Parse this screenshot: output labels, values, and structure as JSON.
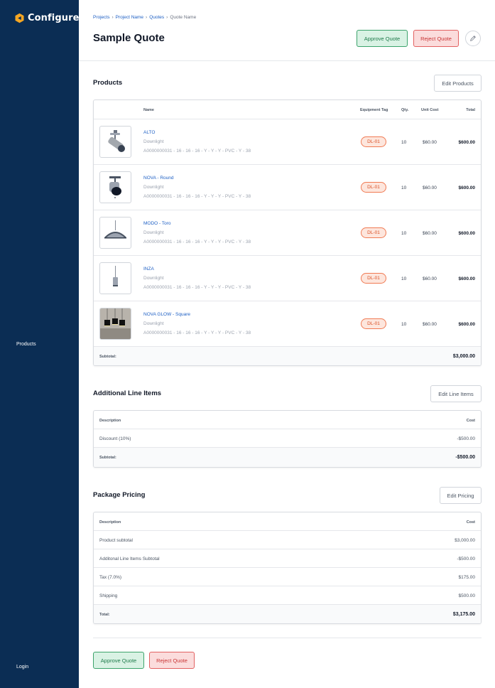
{
  "sidebar": {
    "brand": "Configure",
    "products_label": "Products",
    "login_label": "Login"
  },
  "breadcrumb": [
    "Projects",
    "Project Name",
    "Quotes",
    "Quote Name"
  ],
  "page": {
    "title": "Sample Quote"
  },
  "header": {
    "approve_label": "Approve Quote",
    "reject_label": "Reject Quote",
    "edit_icon": "pencil-icon"
  },
  "products": {
    "title": "Products",
    "edit_label": "Edit Products",
    "columns": {
      "name": "Name",
      "tag": "Equipment Tag",
      "qty": "Qty.",
      "unit": "Unit Cost",
      "total": "Total"
    },
    "rows": [
      {
        "name": "ALTO",
        "category": "Downlight",
        "sku": "A0000000031 - 16 - 16 - 16 - Y - Y - Y - PVC - Y - 38",
        "tag": "DL-01",
        "qty": "10",
        "unit_cost": "$60.00",
        "total": "$600.00",
        "icon": "spotlight-icon"
      },
      {
        "name": "NOVA - Round",
        "category": "Downlight",
        "sku": "A0000000031 - 16 - 16 - 16 - Y - Y - Y - PVC - Y - 38",
        "tag": "DL-01",
        "qty": "10",
        "unit_cost": "$60.00",
        "total": "$600.00",
        "icon": "track-light-icon"
      },
      {
        "name": "MODO - Toro",
        "category": "Downlight",
        "sku": "A0000000031 - 16 - 16 - 16 - Y - Y - Y - PVC - Y - 38",
        "tag": "DL-01",
        "qty": "10",
        "unit_cost": "$60.00",
        "total": "$600.00",
        "icon": "pendant-dome-icon"
      },
      {
        "name": "INZA",
        "category": "Downlight",
        "sku": "A0000000031 - 16 - 16 - 16 - Y - Y - Y - PVC - Y - 38",
        "tag": "DL-01",
        "qty": "10",
        "unit_cost": "$60.00",
        "total": "$600.00",
        "icon": "pendant-cylinder-icon"
      },
      {
        "name": "NOVA GLOW - Square",
        "category": "Downlight",
        "sku": "A0000000031 - 16 - 16 - 16 - Y - Y - Y - PVC - Y - 38",
        "tag": "DL-01",
        "qty": "10",
        "unit_cost": "$60.00",
        "total": "$600.00",
        "icon": "pendant-photo-icon"
      }
    ],
    "subtotal_label": "Subtotal:",
    "subtotal_value": "$3,000.00"
  },
  "additional": {
    "title": "Additional Line Items",
    "edit_label": "Edit Line Items",
    "col_description": "Description",
    "col_cost": "Cost",
    "rows": [
      {
        "description": "Discount (10%)",
        "cost": "-$500.00"
      }
    ],
    "subtotal_label": "Subtotal:",
    "subtotal_value": "-$500.00"
  },
  "pricing": {
    "title": "Package Pricing",
    "edit_label": "Edit Pricing",
    "col_description": "Description",
    "col_cost": "Cost",
    "rows": [
      {
        "description": "Product subtotal",
        "cost": "$3,000.00"
      },
      {
        "description": "Additonal Line Items Subtotal",
        "cost": "-$500.00"
      },
      {
        "description": "Tax (7.0%)",
        "cost": "$175.00"
      },
      {
        "description": "Shipping",
        "cost": "$500.00"
      }
    ],
    "total_label": "Total:",
    "total_value": "$3,175.00"
  },
  "footer": {
    "approve_label": "Approve Quote",
    "reject_label": "Reject Quote"
  },
  "colors": {
    "sidebar": "#0b2d54",
    "link": "#1d5fc4",
    "logo": "#f5a623",
    "approve": "#3ca36b",
    "reject": "#e26161",
    "tag": "#f07a53"
  }
}
